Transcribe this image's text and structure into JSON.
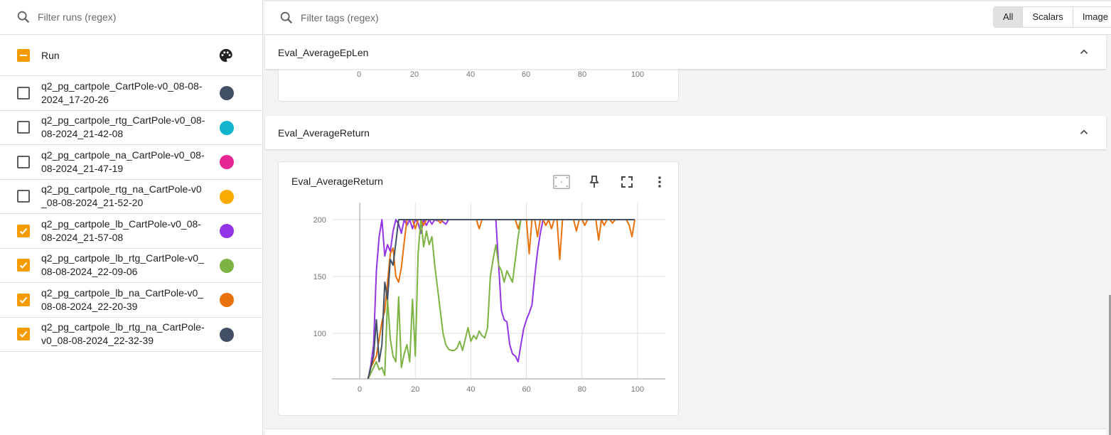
{
  "sidebar": {
    "search_placeholder": "Filter runs (regex)",
    "header_label": "Run",
    "runs": [
      {
        "name": "q2_pg_cartpole_CartPole-v0_08-08-2024_17-20-26",
        "checked": false,
        "color": "#425066"
      },
      {
        "name": "q2_pg_cartpole_rtg_CartPole-v0_08-08-2024_21-42-08",
        "checked": false,
        "color": "#12b5cb"
      },
      {
        "name": "q2_pg_cartpole_na_CartPole-v0_08-08-2024_21-47-19",
        "checked": false,
        "color": "#e52592"
      },
      {
        "name": "q2_pg_cartpole_rtg_na_CartPole-v0_08-08-2024_21-52-20",
        "checked": false,
        "color": "#f9ab00"
      },
      {
        "name": "q2_pg_cartpole_lb_CartPole-v0_08-08-2024_21-57-08",
        "checked": true,
        "color": "#9334e6"
      },
      {
        "name": "q2_pg_cartpole_lb_rtg_CartPole-v0_08-08-2024_22-09-06",
        "checked": true,
        "color": "#7cb342"
      },
      {
        "name": "q2_pg_cartpole_lb_na_CartPole-v0_08-08-2024_22-20-39",
        "checked": true,
        "color": "#e8710a"
      },
      {
        "name": "q2_pg_cartpole_lb_rtg_na_CartPole-v0_08-08-2024_22-32-39",
        "checked": true,
        "color": "#425066"
      }
    ]
  },
  "topbar": {
    "search_placeholder": "Filter tags (regex)",
    "tabs": [
      "All",
      "Scalars",
      "Image"
    ]
  },
  "sections": {
    "eplen_title": "Eval_AverageEpLen",
    "return_title": "Eval_AverageReturn"
  },
  "card": {
    "title": "Eval_AverageReturn"
  },
  "eplen_axis_ticks": [
    "0",
    "20",
    "40",
    "60",
    "80",
    "100"
  ],
  "chart_data": {
    "type": "line",
    "title": "Eval_AverageReturn",
    "xlim": [
      -10,
      110
    ],
    "ylim": [
      60,
      215
    ],
    "x_ticks": [
      0,
      20,
      40,
      60,
      80,
      100
    ],
    "y_ticks": [
      100,
      150,
      200
    ],
    "grid": true,
    "series": [
      {
        "color": "#9334e6",
        "x": [
          3,
          4,
          5,
          6,
          7,
          8,
          9,
          10,
          11,
          12,
          13,
          14,
          15,
          16,
          17,
          18,
          19,
          20,
          21,
          22,
          23,
          24,
          25,
          26,
          27,
          28,
          29,
          30,
          31,
          32,
          33,
          34,
          35,
          36,
          37,
          38,
          39,
          40,
          41,
          42,
          43,
          44,
          45,
          46,
          47,
          48,
          49,
          50,
          51,
          52,
          53,
          54,
          55,
          56,
          57,
          58,
          59,
          60,
          61,
          62,
          63,
          64,
          65,
          66,
          67,
          68,
          69,
          70,
          71,
          72,
          73,
          74,
          75,
          76,
          77,
          78,
          79,
          80,
          81,
          82,
          83,
          84,
          85,
          86,
          87,
          88,
          89,
          90,
          91,
          92,
          93,
          94,
          95,
          96,
          97,
          98,
          99
        ],
        "y": [
          60,
          72,
          90,
          155,
          185,
          200,
          168,
          178,
          172,
          190,
          200,
          196,
          188,
          200,
          195,
          200,
          192,
          200,
          197,
          188,
          200,
          195,
          200,
          196,
          200,
          199,
          200,
          198,
          196,
          200,
          200,
          200,
          200,
          200,
          200,
          200,
          200,
          200,
          200,
          200,
          200,
          200,
          200,
          200,
          200,
          200,
          200,
          160,
          120,
          112,
          110,
          90,
          82,
          80,
          75,
          90,
          104,
          112,
          118,
          125,
          150,
          172,
          188,
          200,
          200,
          200,
          200,
          200,
          200,
          200,
          200,
          200,
          200,
          200,
          200,
          200,
          200,
          200,
          200,
          200,
          200,
          200,
          200,
          200,
          200,
          200,
          200,
          200,
          200,
          200,
          200,
          200,
          200,
          200,
          200,
          200,
          200
        ]
      },
      {
        "color": "#e8710a",
        "x": [
          3,
          4,
          5,
          6,
          7,
          8,
          9,
          10,
          11,
          12,
          13,
          14,
          15,
          16,
          17,
          18,
          19,
          20,
          21,
          22,
          23,
          24,
          25,
          26,
          27,
          28,
          29,
          30,
          31,
          32,
          33,
          34,
          35,
          36,
          37,
          38,
          39,
          40,
          41,
          42,
          43,
          44,
          45,
          46,
          47,
          48,
          49,
          50,
          51,
          52,
          53,
          54,
          55,
          56,
          57,
          58,
          59,
          60,
          61,
          62,
          63,
          64,
          65,
          66,
          67,
          68,
          69,
          70,
          71,
          72,
          73,
          74,
          75,
          76,
          77,
          78,
          79,
          80,
          81,
          82,
          83,
          84,
          85,
          86,
          87,
          88,
          89,
          90,
          91,
          92,
          93,
          94,
          95,
          96,
          97,
          98,
          99
        ],
        "y": [
          60,
          70,
          75,
          80,
          95,
          110,
          120,
          145,
          170,
          175,
          150,
          145,
          158,
          180,
          200,
          200,
          200,
          192,
          200,
          200,
          195,
          200,
          200,
          200,
          200,
          200,
          197,
          200,
          200,
          200,
          200,
          200,
          200,
          200,
          200,
          200,
          200,
          200,
          200,
          200,
          192,
          200,
          200,
          200,
          200,
          200,
          200,
          200,
          200,
          200,
          200,
          200,
          200,
          200,
          192,
          200,
          200,
          200,
          170,
          200,
          200,
          185,
          200,
          200,
          195,
          200,
          192,
          200,
          200,
          165,
          200,
          200,
          200,
          200,
          200,
          190,
          200,
          200,
          195,
          200,
          200,
          200,
          200,
          182,
          200,
          195,
          200,
          200,
          197,
          200,
          200,
          200,
          200,
          200,
          195,
          185,
          200
        ]
      },
      {
        "color": "#7cb342",
        "x": [
          3,
          4,
          5,
          6,
          7,
          8,
          9,
          10,
          11,
          12,
          13,
          14,
          15,
          16,
          17,
          18,
          19,
          20,
          21,
          22,
          23,
          24,
          25,
          26,
          27,
          28,
          29,
          30,
          31,
          32,
          33,
          34,
          35,
          36,
          37,
          38,
          39,
          40,
          41,
          42,
          43,
          44,
          45,
          46,
          47,
          48,
          49,
          50,
          51,
          52,
          53,
          54,
          55,
          56,
          57,
          58,
          59,
          60,
          61,
          62,
          63,
          64,
          65,
          66,
          67,
          68,
          69,
          70,
          71,
          72,
          73,
          74,
          75,
          76,
          77,
          78,
          79,
          80,
          81,
          82,
          83,
          84,
          85,
          86,
          87,
          88,
          89,
          90,
          91,
          92,
          93,
          94,
          95,
          96,
          97,
          98,
          99
        ],
        "y": [
          60,
          65,
          70,
          75,
          68,
          70,
          63,
          130,
          95,
          80,
          75,
          132,
          70,
          82,
          90,
          75,
          130,
          80,
          170,
          200,
          176,
          190,
          178,
          185,
          160,
          140,
          120,
          100,
          90,
          86,
          85,
          85,
          87,
          93,
          85,
          95,
          105,
          93,
          98,
          95,
          102,
          98,
          96,
          105,
          150,
          165,
          178,
          160,
          155,
          145,
          155,
          150,
          145,
          165,
          185,
          200,
          200,
          200,
          200,
          200,
          200,
          200,
          200,
          200,
          200,
          200,
          200,
          200,
          200,
          200,
          200,
          200,
          200,
          200,
          200,
          200,
          200,
          200,
          200,
          200,
          200,
          200,
          200,
          200,
          200,
          200,
          200,
          200,
          200,
          200,
          200,
          200,
          200,
          200,
          200,
          200,
          200
        ]
      },
      {
        "color": "#425066",
        "x": [
          3,
          4,
          5,
          6,
          7,
          8,
          9,
          10,
          11,
          12,
          13,
          14,
          15,
          16,
          17,
          18,
          19,
          20,
          21,
          22,
          23,
          24,
          25,
          26,
          27,
          28,
          29,
          30,
          31,
          32,
          33,
          34,
          35,
          36,
          37,
          38,
          39,
          40,
          41,
          42,
          43,
          44,
          45,
          46,
          47,
          48,
          49,
          50,
          51,
          52,
          53,
          54,
          55,
          56,
          57,
          58,
          59,
          60,
          61,
          62,
          63,
          64,
          65,
          66,
          67,
          68,
          69,
          70,
          71,
          72,
          73,
          74,
          75,
          76,
          77,
          78,
          79,
          80,
          81,
          82,
          83,
          84,
          85,
          86,
          87,
          88,
          89,
          90,
          91,
          92,
          93,
          94,
          95,
          96,
          97,
          98,
          99
        ],
        "y": [
          60,
          70,
          80,
          112,
          75,
          90,
          145,
          130,
          165,
          160,
          180,
          200,
          200,
          200,
          200,
          200,
          200,
          200,
          200,
          200,
          200,
          200,
          200,
          200,
          200,
          200,
          200,
          200,
          200,
          200,
          200,
          200,
          200,
          200,
          200,
          200,
          200,
          200,
          200,
          200,
          200,
          200,
          200,
          200,
          200,
          200,
          200,
          200,
          200,
          200,
          200,
          200,
          200,
          200,
          200,
          200,
          200,
          200,
          200,
          200,
          200,
          200,
          200,
          200,
          200,
          200,
          200,
          200,
          200,
          200,
          200,
          200,
          200,
          200,
          200,
          200,
          200,
          200,
          200,
          200,
          200,
          200,
          200,
          200,
          200,
          200,
          200,
          200,
          200,
          200,
          200,
          200,
          200,
          200,
          200,
          200,
          200
        ]
      }
    ]
  }
}
